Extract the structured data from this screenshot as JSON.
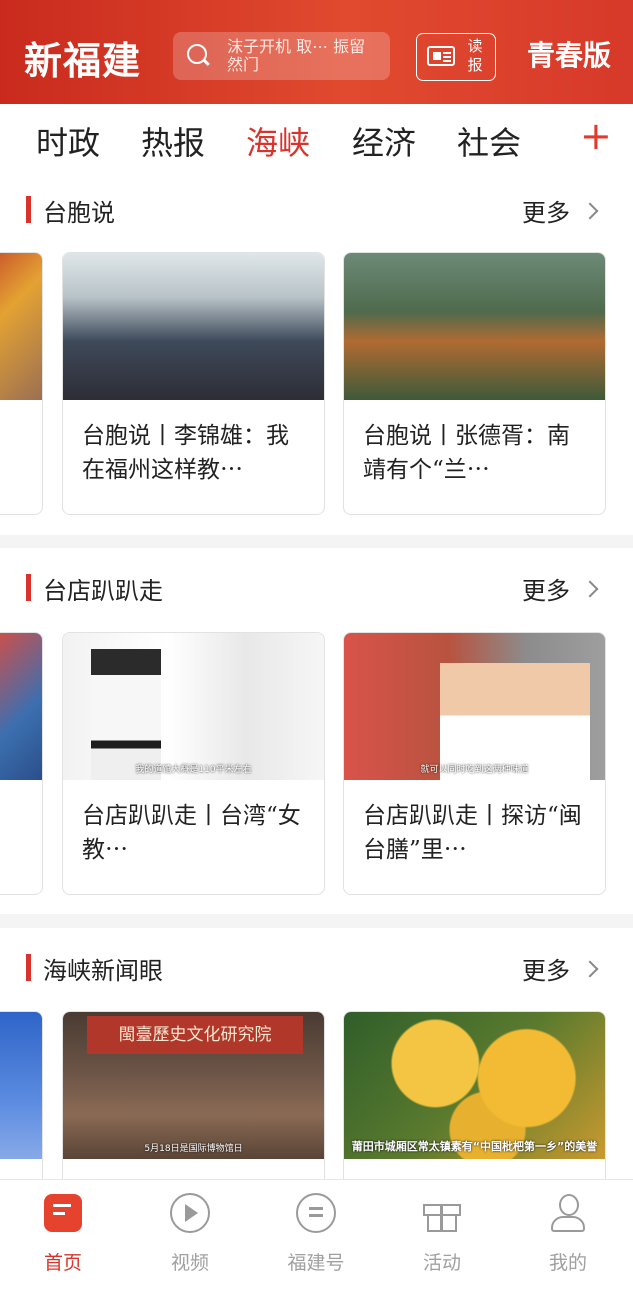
{
  "header": {
    "logo": "新福建",
    "search_hint": "沫子开机 取⋯ 振留然门",
    "read_label": "读报",
    "youth_label": "青春版"
  },
  "tabs": [
    "时政",
    "热报",
    "海峡",
    "经济",
    "社会"
  ],
  "active_tab": "海峡",
  "sections": [
    {
      "title": "台胞说",
      "more": "更多",
      "cards": [
        {
          "title": "台胞说丨李锦雄：我在福州这样教⋯",
          "caption": ""
        },
        {
          "title": "台胞说丨张德胥：南靖有个“兰⋯",
          "caption": ""
        }
      ]
    },
    {
      "title": "台店趴趴走",
      "more": "更多",
      "cards": [
        {
          "title": "台店趴趴走丨台湾“女教⋯",
          "caption": "我的道馆大概是110平米左右"
        },
        {
          "title": "台店趴趴走丨探访“闽台膳”里⋯",
          "caption": "就可以同时吃到这两种味道"
        }
      ]
    },
    {
      "title": "海峡新闻眼",
      "more": "更多",
      "cards": [
        {
          "title": "",
          "caption": "5月18日是国际博物馆日",
          "sign": "閩臺歷史文化研究院"
        },
        {
          "title": "",
          "caption": "莆田市城厢区常太镇素有“中国枇杷第一乡”的美誉"
        }
      ]
    }
  ],
  "tabbar": [
    {
      "label": "首页",
      "icon": "home-icon",
      "active": true
    },
    {
      "label": "视频",
      "icon": "play-icon",
      "active": false
    },
    {
      "label": "福建号",
      "icon": "chat-icon",
      "active": false
    },
    {
      "label": "活动",
      "icon": "gift-icon",
      "active": false
    },
    {
      "label": "我的",
      "icon": "user-icon",
      "active": false
    }
  ],
  "colors": {
    "brand": "#d8342b",
    "header": "#dd4430"
  }
}
